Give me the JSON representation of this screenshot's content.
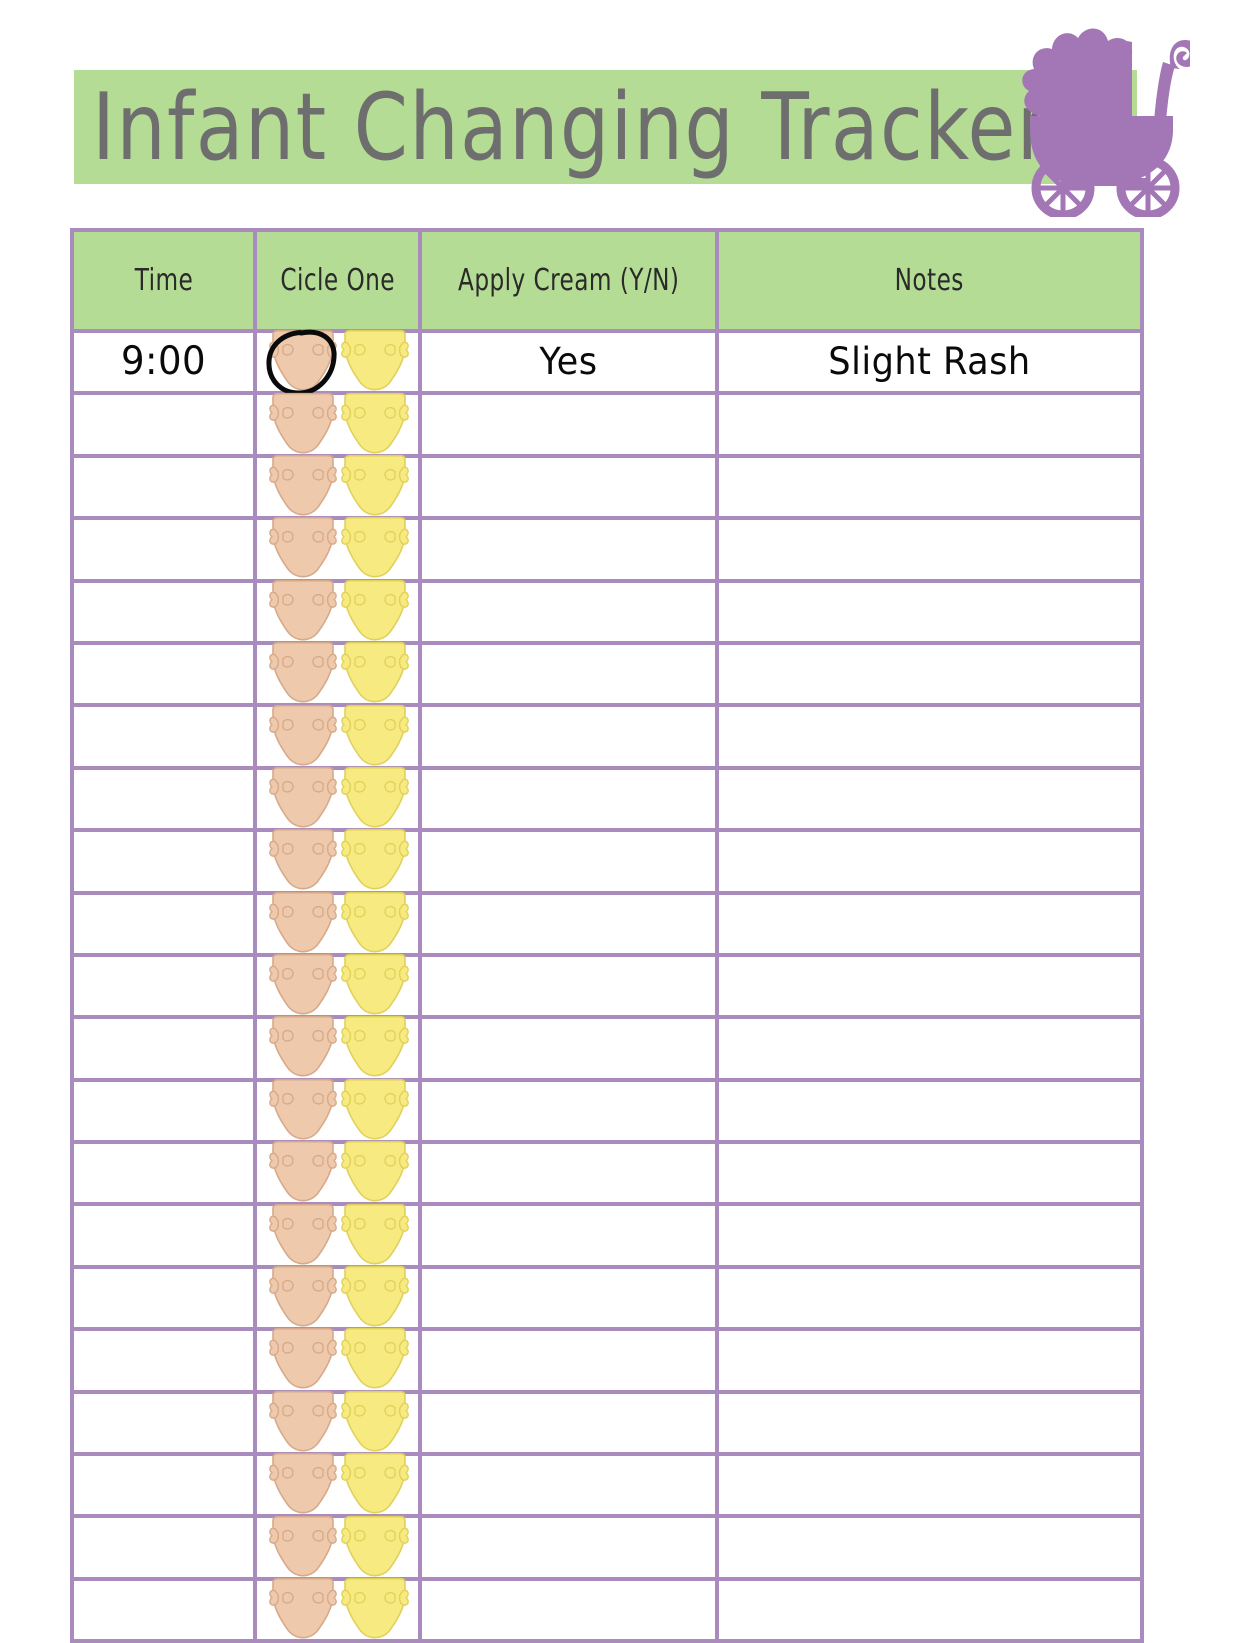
{
  "document": {
    "title": "Infant Changing Tracker",
    "type": "printable-tracker-sheet"
  },
  "theme": {
    "banner_green": "#b5dc95",
    "grid_purple": "#a98bbd",
    "carriage_purple": "#a376b5",
    "title_gray": "#6e6e6e",
    "diaper_tan": "#efc9ab",
    "diaper_tan_outline": "#d6a98a",
    "diaper_yellow": "#f7ea80",
    "diaper_yellow_outline": "#e0d05c",
    "ink_black": "#0a0a0a",
    "page_white": "#ffffff"
  },
  "decorations": {
    "carriage_icon": "baby-carriage-icon"
  },
  "table": {
    "columns": [
      {
        "key": "time",
        "label": "Time"
      },
      {
        "key": "circle",
        "label": "Cicle One"
      },
      {
        "key": "cream",
        "label": "Apply Cream (Y/N)"
      },
      {
        "key": "notes",
        "label": "Notes"
      }
    ],
    "circle_options": [
      "soiled-diaper-brown",
      "wet-diaper-yellow"
    ],
    "rows": [
      {
        "time": "9:00",
        "circled": "soiled-diaper-brown",
        "cream": "Yes",
        "notes": "Slight Rash"
      },
      {
        "time": "",
        "circled": "",
        "cream": "",
        "notes": ""
      },
      {
        "time": "",
        "circled": "",
        "cream": "",
        "notes": ""
      },
      {
        "time": "",
        "circled": "",
        "cream": "",
        "notes": ""
      },
      {
        "time": "",
        "circled": "",
        "cream": "",
        "notes": ""
      },
      {
        "time": "",
        "circled": "",
        "cream": "",
        "notes": ""
      },
      {
        "time": "",
        "circled": "",
        "cream": "",
        "notes": ""
      },
      {
        "time": "",
        "circled": "",
        "cream": "",
        "notes": ""
      },
      {
        "time": "",
        "circled": "",
        "cream": "",
        "notes": ""
      },
      {
        "time": "",
        "circled": "",
        "cream": "",
        "notes": ""
      },
      {
        "time": "",
        "circled": "",
        "cream": "",
        "notes": ""
      },
      {
        "time": "",
        "circled": "",
        "cream": "",
        "notes": ""
      },
      {
        "time": "",
        "circled": "",
        "cream": "",
        "notes": ""
      },
      {
        "time": "",
        "circled": "",
        "cream": "",
        "notes": ""
      },
      {
        "time": "",
        "circled": "",
        "cream": "",
        "notes": ""
      },
      {
        "time": "",
        "circled": "",
        "cream": "",
        "notes": ""
      },
      {
        "time": "",
        "circled": "",
        "cream": "",
        "notes": ""
      },
      {
        "time": "",
        "circled": "",
        "cream": "",
        "notes": ""
      },
      {
        "time": "",
        "circled": "",
        "cream": "",
        "notes": ""
      },
      {
        "time": "",
        "circled": "",
        "cream": "",
        "notes": ""
      },
      {
        "time": "",
        "circled": "",
        "cream": "",
        "notes": ""
      }
    ]
  }
}
